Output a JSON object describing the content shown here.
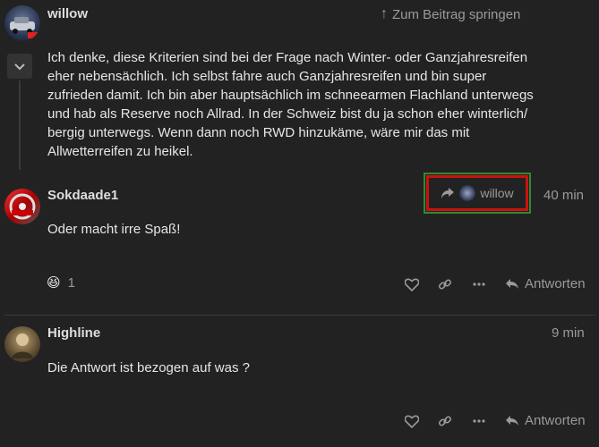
{
  "post1": {
    "username": "willow",
    "jump_label": "Zum Beitrag springen",
    "text": "Ich denke, diese Kriterien sind bei der Frage nach Winter- oder Ganzjahresreifen eher nebensächlich. Ich selbst fahre auch Ganzjahresreifen und bin super zufrieden damit. Ich bin aber hauptsächlich im schneearmen Flachland unterwegs und hab als Reserve noch Allrad. In der Schweiz bist du ja schon eher winterlich/ bergig unterwegs. Wenn dann noch RWD hinzukäme, wäre mir das mit Allwetterreifen zu heikel."
  },
  "post2": {
    "username": "Sokdaade1",
    "reply_to_user": "willow",
    "time": "40 min",
    "text": "Oder macht irre Spaß!",
    "reaction_emoji": "😆",
    "reaction_count": "1",
    "reply_label": "Antworten"
  },
  "post3": {
    "username": "Highline",
    "time": "9 min",
    "text": "Die Antwort ist bezogen auf was ?",
    "reply_label": "Antworten"
  },
  "colors": {
    "background": "#222222",
    "highlight_outer": "#2e8b2e",
    "highlight_inner": "#cc1111"
  }
}
